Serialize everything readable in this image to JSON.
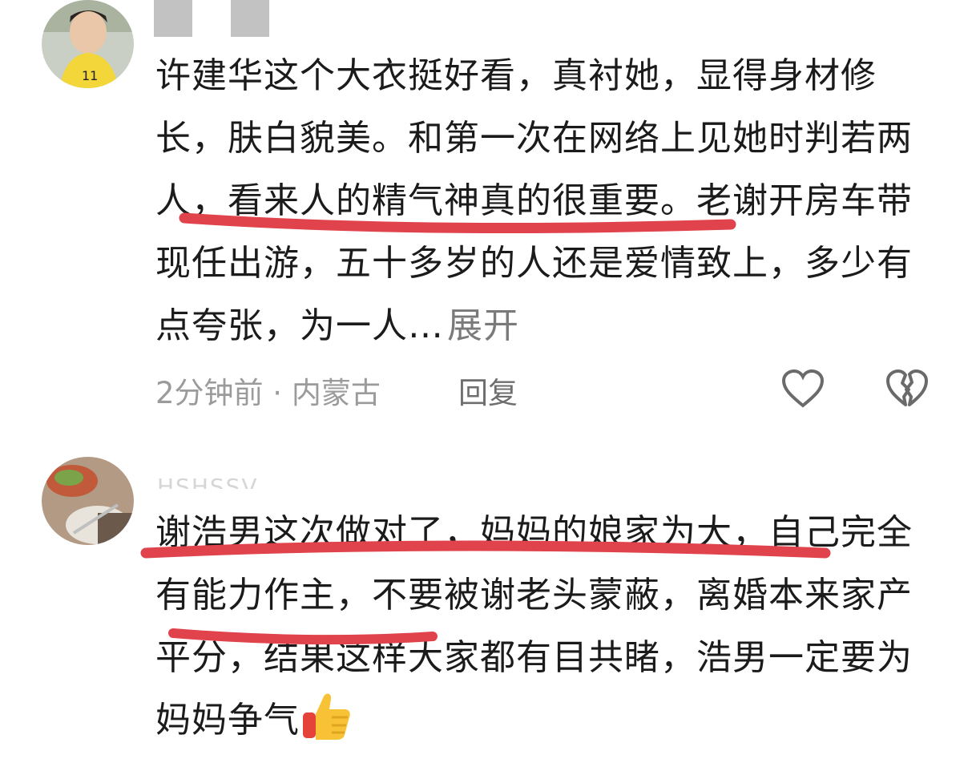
{
  "comments": [
    {
      "avatar_icon": "user-avatar-photo",
      "text": "许建华这个大衣挺好看，真衬她，显得身材修长，肤白貌美。和第一次在网络上见她时判若两人，看来人的精气神真的很重要。老谢开房车带现任出游，五十多岁的人还是爱情致上，多少有点夸张，为一人…",
      "expand_label": "展开",
      "meta": "2分钟前 · 内蒙古",
      "reply_label": "回复",
      "like_icon": "heart-outline-icon",
      "dislike_icon": "broken-heart-icon"
    },
    {
      "avatar_icon": "food-plate-avatar",
      "username": "HSHSSV",
      "text": "谢浩男这次做对了，妈妈的娘家为大，自己完全有能力作主，不要被谢老头蒙蔽，离婚本来家产平分，结果这样大家都有目共睹，浩男一定要为妈妈争气",
      "emoji_icon": "thumbs-up-icon"
    }
  ],
  "colors": {
    "underline": "#e0434b",
    "meta": "#9b9b9b",
    "reply": "#6e6e6e",
    "text": "#1b1b1b"
  }
}
